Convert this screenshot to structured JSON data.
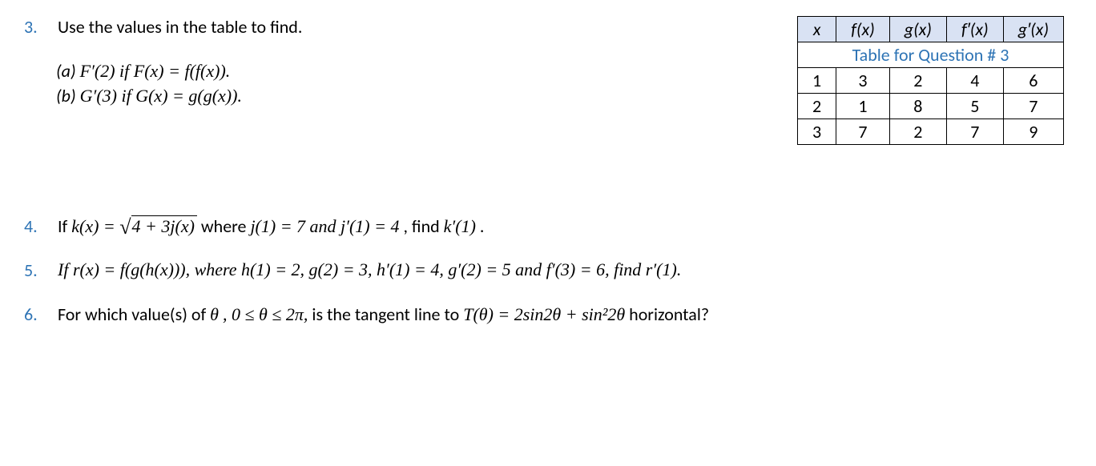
{
  "q3": {
    "number": "3.",
    "prompt": "Use the values in the table to find.",
    "parts": {
      "a_label": "(a)",
      "a_text": "F′(2) if  F(x)  =  f(f(x)).",
      "b_label": "(b)",
      "b_text": "G′(3) if  G(x) = g(g(x))."
    },
    "table": {
      "title": "Table for Question # 3",
      "headers": [
        "x",
        "f(x)",
        "g(x)",
        "f′(x)",
        "g′(x)"
      ],
      "rows": [
        [
          "1",
          "3",
          "2",
          "4",
          "6"
        ],
        [
          "2",
          "1",
          "8",
          "5",
          "7"
        ],
        [
          "3",
          "7",
          "2",
          "7",
          "9"
        ]
      ]
    }
  },
  "q4": {
    "number": "4.",
    "text_before": "If ",
    "kx": "k(x) = ",
    "radicand": "4 + 3j(x)",
    "text_mid": " where ",
    "cond1": "j(1) = 7 and j′(1) = 4",
    "text_after": ", find ",
    "find": "k′(1)",
    "period": "."
  },
  "q5": {
    "number": "5.",
    "text": "If  r(x) = f(g(h(x))), where  h(1) = 2, g(2) = 3, h′(1) = 4, g′(2) = 5  and f′(3) = 6, find r′(1)."
  },
  "q6": {
    "number": "6.",
    "text_before": "For which value(s) of ",
    "theta": "θ",
    "range": ",  0 ≤ θ ≤ 2π,",
    "text_mid": "  is the tangent line to ",
    "func": "T(θ) = 2sin2θ + sin²2θ",
    "text_after": "  horizontal?"
  }
}
